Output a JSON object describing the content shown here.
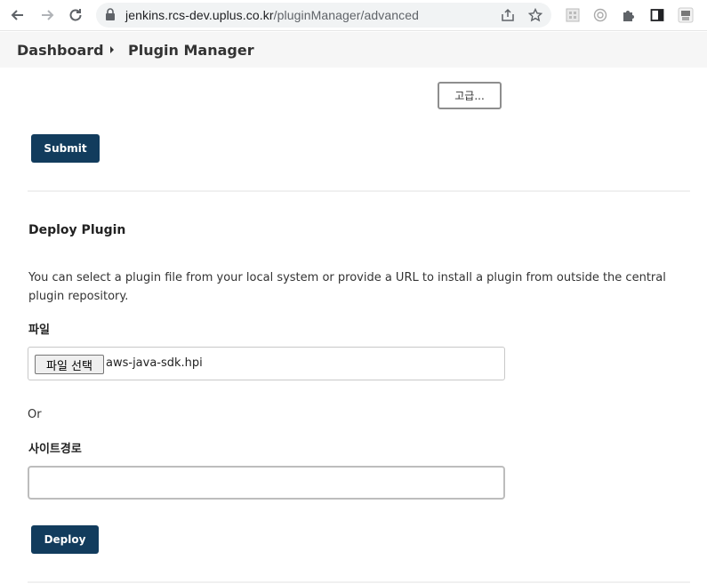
{
  "browser": {
    "url_host": "jenkins.rcs-dev.uplus.co.kr",
    "url_path": "/pluginManager/advanced"
  },
  "breadcrumb": {
    "items": [
      "Dashboard",
      "Plugin Manager"
    ]
  },
  "advanced": {
    "button_label": "고급...",
    "submit_label": "Submit"
  },
  "deploy": {
    "title": "Deploy Plugin",
    "description": "You can select a plugin file from your local system or provide a URL to install a plugin from outside the central plugin repository.",
    "file_label": "파일",
    "file_button_label": "파일 선택",
    "file_name": "aws-java-sdk.hpi",
    "or_text": "Or",
    "url_label": "사이트경로",
    "url_value": "",
    "deploy_label": "Deploy"
  },
  "colors": {
    "primary_button": "#123c5d",
    "breadcrumb_bg": "#f6f6f6"
  }
}
